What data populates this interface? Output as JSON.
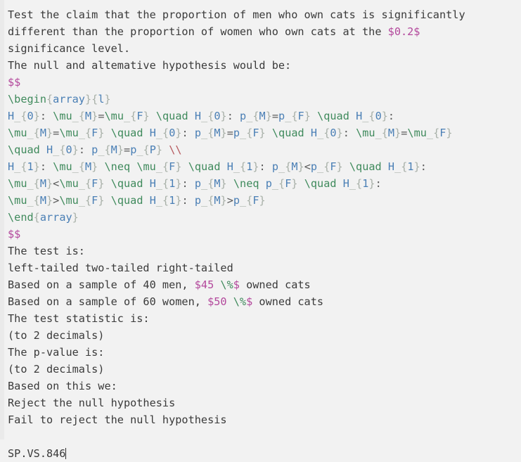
{
  "editor": {
    "background_color": "#f2f2f2",
    "gutter_color": "#eaeaea",
    "text_color": "#3a3a3a",
    "font_size_px": 15,
    "line_height_px": 24
  },
  "colors": {
    "math_delimiter": "#b3489c",
    "latex_command": "#3f8a5c",
    "brace": "#a8b0a8",
    "identifier": "#4a7fb5",
    "line_break": "#b5595e",
    "plain_text": "#3a3a3a"
  },
  "lines": [
    {
      "id": "l1",
      "text": "Test the claim that the proportion of men who own cats is significantly"
    },
    {
      "id": "l2",
      "text": "different than the proportion of women who own cats at the $0.2$"
    },
    {
      "id": "l3",
      "text": "significance level."
    },
    {
      "id": "l4",
      "text": "The null and altemative hypothesis would be:"
    },
    {
      "id": "l5",
      "text": "$$"
    },
    {
      "id": "l6",
      "text": "\\begin{array}{l}"
    },
    {
      "id": "l7",
      "text": "H_{0}: \\mu_{M}=\\mu_{F} \\quad H_{0}: p_{M}=p_{F} \\quad H_{0}:"
    },
    {
      "id": "l8",
      "text": "\\mu_{M}=\\mu_{F} \\quad H_{0}: p_{M}=p_{F} \\quad H_{0}: \\mu_{M}=\\mu_{F}"
    },
    {
      "id": "l9",
      "text": "\\quad H_{0}: p_{M}=p_{P} \\\\"
    },
    {
      "id": "l10",
      "text": "H_{1}: \\mu_{M} \\neq \\mu_{F} \\quad H_{1}: p_{M}<p_{F} \\quad H_{1}:"
    },
    {
      "id": "l11",
      "text": "\\mu_{M}<\\mu_{F} \\quad H_{1}: p_{M} \\neq p_{F} \\quad H_{1}:"
    },
    {
      "id": "l12",
      "text": "\\mu_{M}>\\mu_{F} \\quad H_{1}: p_{M}>p_{F}"
    },
    {
      "id": "l13",
      "text": "\\end{array}"
    },
    {
      "id": "l14",
      "text": "$$"
    },
    {
      "id": "l15",
      "text": "The test is:"
    },
    {
      "id": "l16",
      "text": "left-tailed two-tailed right-tailed"
    },
    {
      "id": "l17",
      "text": "Based on a sample of 40 men, $45 \\%$ owned cats"
    },
    {
      "id": "l18",
      "text": "Based on a sample of 60 women, $50 \\%$ owned cats"
    },
    {
      "id": "l19",
      "text": "The test statistic is:"
    },
    {
      "id": "l20",
      "text": "(to 2 decimals)"
    },
    {
      "id": "l21",
      "text": "The p-value is:"
    },
    {
      "id": "l22",
      "text": "(to 2 decimals)"
    },
    {
      "id": "l23",
      "text": "Based on this we:"
    },
    {
      "id": "l24",
      "text": "Reject the null hypothesis"
    },
    {
      "id": "l25",
      "text": "Fail to reject the null hypothesis"
    },
    {
      "id": "l26",
      "text": ""
    },
    {
      "id": "l27",
      "text": "SP.VS.846"
    }
  ],
  "content": {
    "prompt_line_1": "Test the claim that the proportion of men who own cats is significantly",
    "prompt_line_2_pre": "different than the proportion of women who own cats at the ",
    "significance_level_math": "$0.2$",
    "prompt_line_3": "significance level.",
    "hypothesis_intro": "The null and altemative hypothesis would be:",
    "math_open": "$$",
    "math_close": "$$",
    "array_begin_cmd": "\\begin",
    "array_begin_env": "array",
    "array_begin_align": "l",
    "array_end_cmd": "\\end",
    "array_end_env": "array",
    "test_is_label": "The test is:",
    "test_options": "left-tailed two-tailed right-tailed",
    "sample_men_pre": "Based on a sample of 40 men, ",
    "sample_men_value": "$45",
    "sample_men_pct_cmd": "\\%",
    "sample_men_dollar": "$",
    "sample_men_post": " owned cats",
    "sample_women_pre": "Based on a sample of 60 women, ",
    "sample_women_value": "$50",
    "sample_women_pct_cmd": "\\%",
    "sample_women_dollar": "$",
    "sample_women_post": " owned cats",
    "test_statistic_label": "The test statistic is:",
    "test_statistic_hint": "(to 2 decimals)",
    "p_value_label": "The p-value is:",
    "p_value_hint": "(to 2 decimals)",
    "conclusion_label": "Based on this we:",
    "conclusion_option_1": "Reject the null hypothesis",
    "conclusion_option_2": "Fail to reject the null hypothesis",
    "problem_id": "SP.VS.846"
  },
  "latex_tokens": {
    "h0_line_a": [
      {
        "t": "H",
        "c": "ident"
      },
      {
        "t": "_",
        "c": "brace"
      },
      {
        "t": "{",
        "c": "brace"
      },
      {
        "t": "0",
        "c": "ident"
      },
      {
        "t": "}",
        "c": "brace"
      },
      {
        "t": ": ",
        "c": "plain"
      },
      {
        "t": "\\mu",
        "c": "cmd"
      },
      {
        "t": "_",
        "c": "brace"
      },
      {
        "t": "{",
        "c": "brace"
      },
      {
        "t": "M",
        "c": "ident"
      },
      {
        "t": "}",
        "c": "brace"
      },
      {
        "t": "=",
        "c": "plain"
      },
      {
        "t": "\\mu",
        "c": "cmd"
      },
      {
        "t": "_",
        "c": "brace"
      },
      {
        "t": "{",
        "c": "brace"
      },
      {
        "t": "F",
        "c": "ident"
      },
      {
        "t": "}",
        "c": "brace"
      },
      {
        "t": " ",
        "c": "plain"
      },
      {
        "t": "\\quad",
        "c": "cmd"
      },
      {
        "t": " ",
        "c": "plain"
      },
      {
        "t": "H",
        "c": "ident"
      },
      {
        "t": "_",
        "c": "brace"
      },
      {
        "t": "{",
        "c": "brace"
      },
      {
        "t": "0",
        "c": "ident"
      },
      {
        "t": "}",
        "c": "brace"
      },
      {
        "t": ": ",
        "c": "plain"
      },
      {
        "t": "p",
        "c": "ident"
      },
      {
        "t": "_",
        "c": "brace"
      },
      {
        "t": "{",
        "c": "brace"
      },
      {
        "t": "M",
        "c": "ident"
      },
      {
        "t": "}",
        "c": "brace"
      },
      {
        "t": "=",
        "c": "plain"
      },
      {
        "t": "p",
        "c": "ident"
      },
      {
        "t": "_",
        "c": "brace"
      },
      {
        "t": "{",
        "c": "brace"
      },
      {
        "t": "F",
        "c": "ident"
      },
      {
        "t": "}",
        "c": "brace"
      },
      {
        "t": " ",
        "c": "plain"
      },
      {
        "t": "\\quad",
        "c": "cmd"
      },
      {
        "t": " ",
        "c": "plain"
      },
      {
        "t": "H",
        "c": "ident"
      },
      {
        "t": "_",
        "c": "brace"
      },
      {
        "t": "{",
        "c": "brace"
      },
      {
        "t": "0",
        "c": "ident"
      },
      {
        "t": "}",
        "c": "brace"
      },
      {
        "t": ":",
        "c": "plain"
      }
    ]
  }
}
